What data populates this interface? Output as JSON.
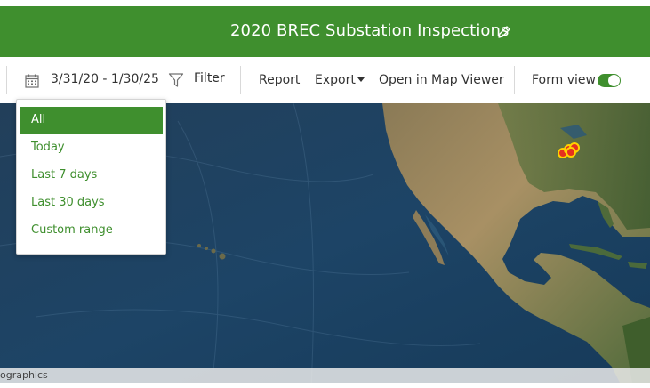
{
  "header": {
    "title": "2020 BREC Substation Inspections",
    "edit_icon": "pencil-icon"
  },
  "toolbar": {
    "date_range": "3/31/20 - 1/30/25",
    "date_icon": "calendar-icon",
    "filter_label": "Filter",
    "filter_icon": "funnel-icon",
    "report_label": "Report",
    "export_label": "Export",
    "map_viewer_label": "Open in Map Viewer",
    "form_view_label": "Form view",
    "form_view_on": true
  },
  "date_menu": {
    "items": [
      {
        "label": "All",
        "selected": true
      },
      {
        "label": "Today",
        "selected": false
      },
      {
        "label": "Last 7 days",
        "selected": false
      },
      {
        "label": "Last 30 days",
        "selected": false
      },
      {
        "label": "Custom range",
        "selected": false
      }
    ]
  },
  "map": {
    "attribution": "ographics"
  },
  "colors": {
    "brand_green": "#3f8f2e",
    "marker_fill": "#e5301f",
    "marker_ring": "#ffd200"
  }
}
